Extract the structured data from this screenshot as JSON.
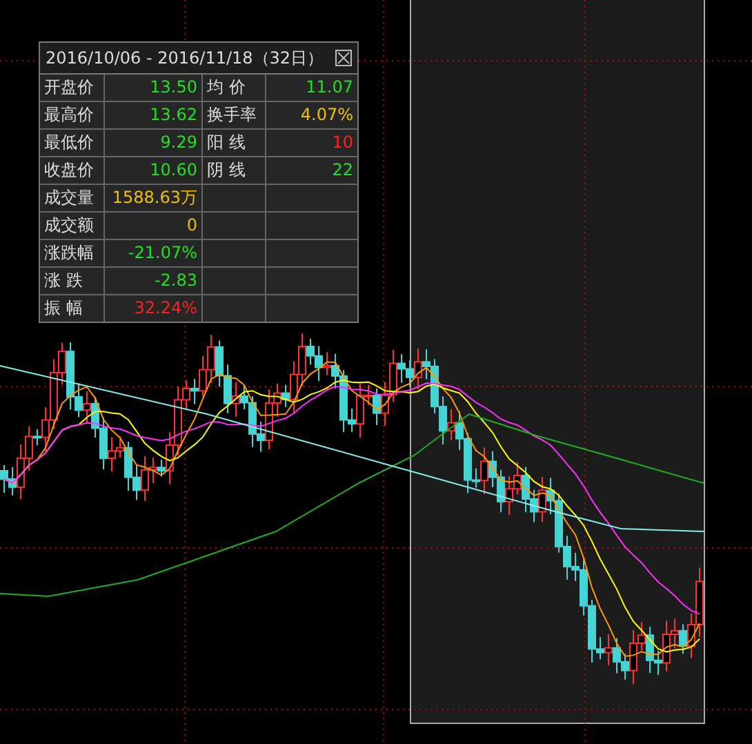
{
  "info_panel": {
    "title": "2016/10/06 - 2016/11/18（32日）",
    "rows": [
      {
        "cells": [
          {
            "kind": "label",
            "text": "开盘价"
          },
          {
            "kind": "fall",
            "text": "13.50"
          },
          {
            "kind": "label",
            "text": "均 价"
          },
          {
            "kind": "fall",
            "text": "11.07"
          }
        ]
      },
      {
        "cells": [
          {
            "kind": "label",
            "text": "最高价"
          },
          {
            "kind": "fall",
            "text": "13.62"
          },
          {
            "kind": "label",
            "text": "换手率"
          },
          {
            "kind": "neutral",
            "text": "4.07%"
          }
        ]
      },
      {
        "cells": [
          {
            "kind": "label",
            "text": "最低价"
          },
          {
            "kind": "fall",
            "text": "9.29"
          },
          {
            "kind": "label",
            "text": "阳 线"
          },
          {
            "kind": "rise",
            "text": "10"
          }
        ]
      },
      {
        "cells": [
          {
            "kind": "label",
            "text": "收盘价"
          },
          {
            "kind": "fall",
            "text": "10.60"
          },
          {
            "kind": "label",
            "text": "阴 线"
          },
          {
            "kind": "fall",
            "text": "22"
          }
        ]
      },
      {
        "cells": [
          {
            "kind": "label",
            "text": "成交量"
          },
          {
            "kind": "neutral",
            "text": "1588.63万"
          }
        ]
      },
      {
        "cells": [
          {
            "kind": "label",
            "text": "成交额"
          },
          {
            "kind": "neutral",
            "text": "0"
          }
        ]
      },
      {
        "cells": [
          {
            "kind": "label",
            "text": "涨跌幅"
          },
          {
            "kind": "fall",
            "text": "-21.07%"
          }
        ]
      },
      {
        "cells": [
          {
            "kind": "label",
            "text": "涨 跌"
          },
          {
            "kind": "fall",
            "text": "-2.83"
          }
        ]
      },
      {
        "cells": [
          {
            "kind": "label",
            "text": "振 幅"
          },
          {
            "kind": "rise",
            "text": "32.24%"
          }
        ]
      }
    ]
  }
}
